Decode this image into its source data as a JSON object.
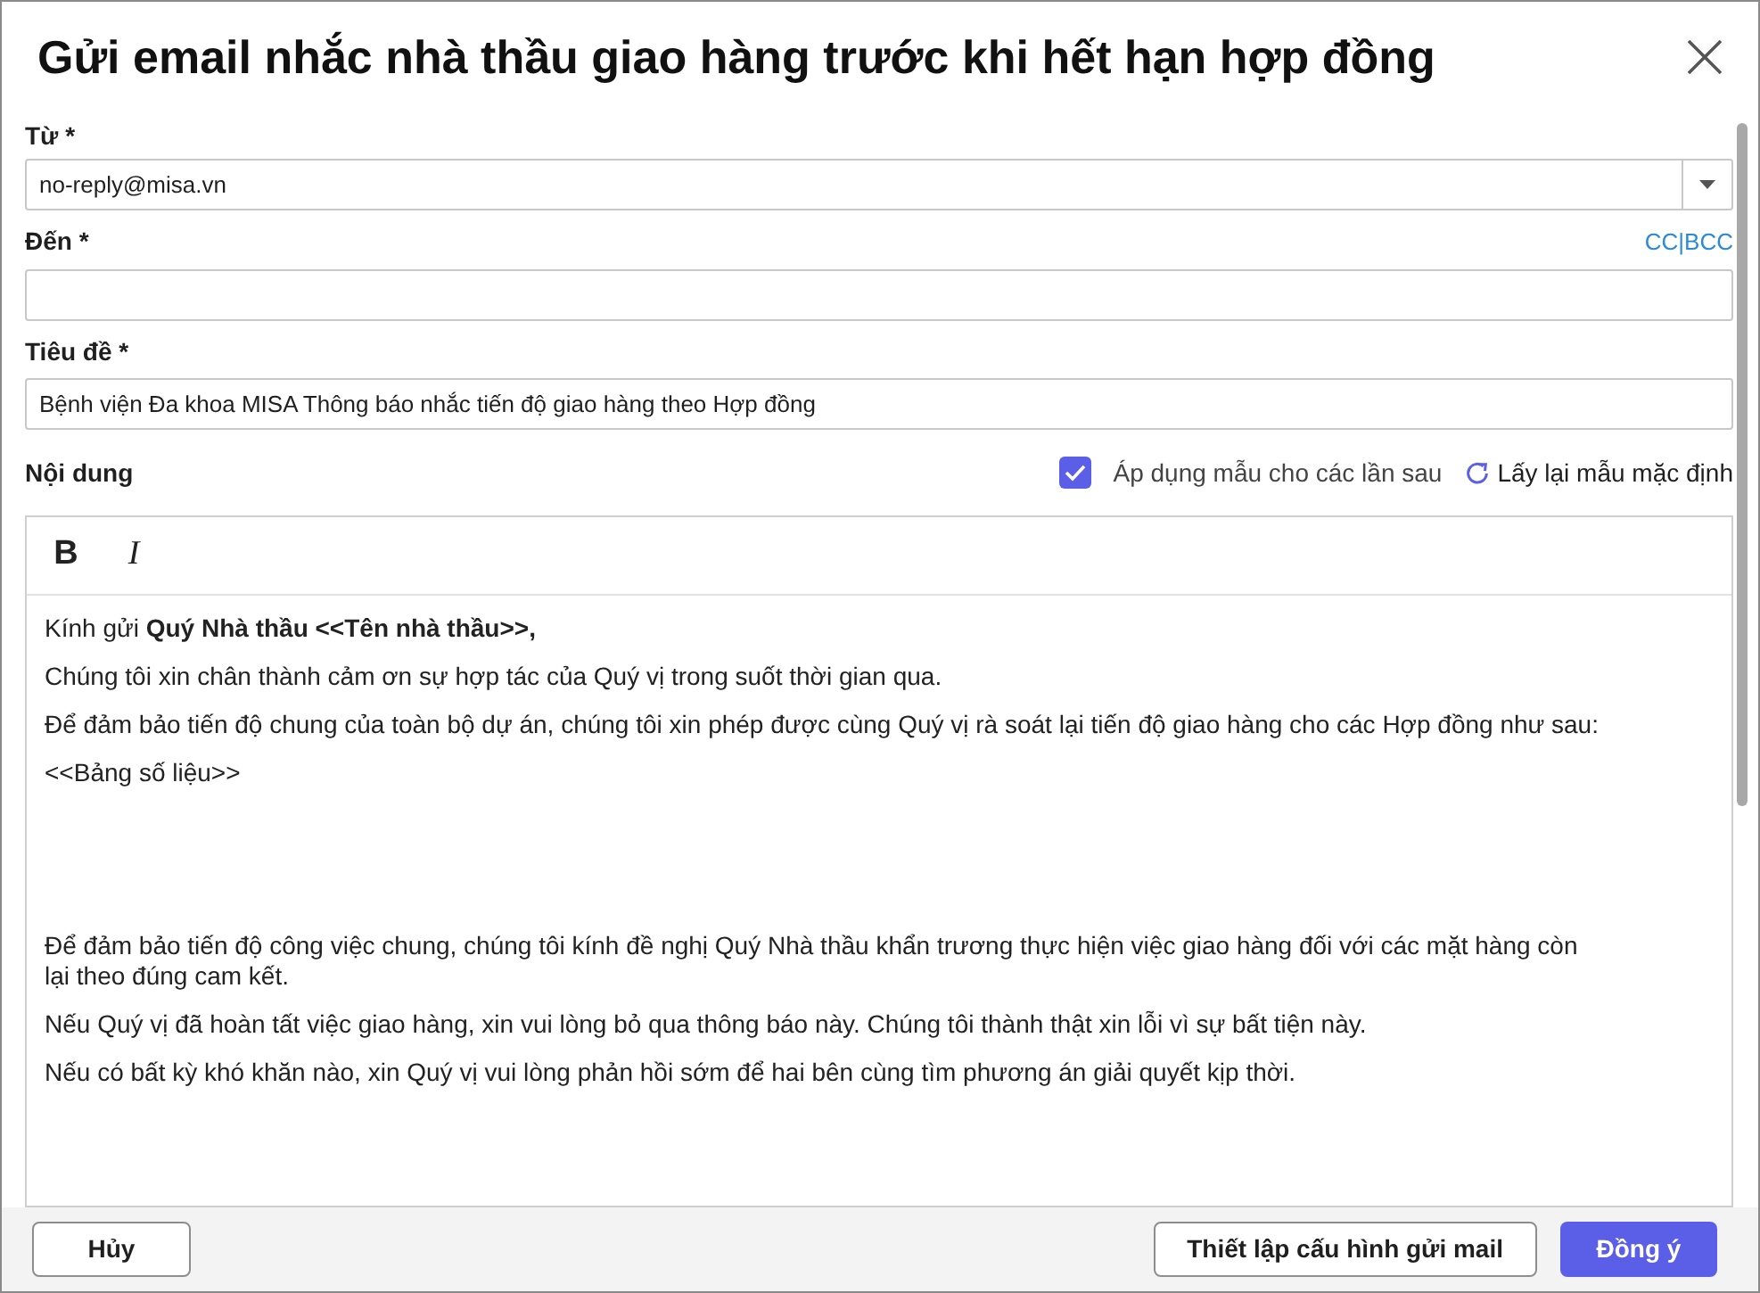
{
  "window": {
    "title": "Gửi email nhắc nhà thầu giao hàng trước khi hết hạn hợp đồng"
  },
  "from": {
    "label": "Từ *",
    "value": "no-reply@misa.vn"
  },
  "to": {
    "label": "Đến *",
    "cc_bcc": "CC|BCC"
  },
  "subject": {
    "label": "Tiêu đề *",
    "value": "Bệnh viện Đa khoa MISA Thông báo nhắc tiến độ giao hàng theo Hợp đồng"
  },
  "content": {
    "label": "Nội dung",
    "apply_template": {
      "label": "Áp dụng mẫu cho các lần sau",
      "checked": true
    },
    "reset_label": "Lấy lại mẫu mặc định",
    "toolbar": [
      "B",
      "I"
    ],
    "paragraphs": [
      "Kính gửi **Quý Nhà thầu <<Tên nhà thầu>>,**",
      "Chúng tôi xin chân thành cảm ơn sự hợp tác của Quý vị trong suốt thời gian qua.",
      "Để đảm bảo tiến độ chung của toàn bộ dự án, chúng tôi xin phép được cùng Quý vị rà soát lại tiến độ giao hàng cho các Hợp đồng như sau:",
      "<<Bảng số liệu>>",
      "Để đảm bảo tiến độ công việc chung, chúng tôi kính đề nghị Quý Nhà thầu khẩn trương thực hiện việc giao hàng đối với các mặt hàng còn lại theo đúng cam kết.",
      "Nếu Quý vị đã hoàn tất việc giao hàng, xin vui lòng bỏ qua thông báo này. Chúng tôi thành thật xin lỗi vì sự bất tiện này.",
      "Nếu có bất kỳ khó khăn nào, xin Quý vị vui lòng phản hồi sớm để hai bên cùng tìm phương án giải quyết kịp thời."
    ]
  },
  "buttons": {
    "cancel": "Hủy",
    "config": "Thiết lập cấu hình gửi mail",
    "ok": "Đồng ý"
  }
}
